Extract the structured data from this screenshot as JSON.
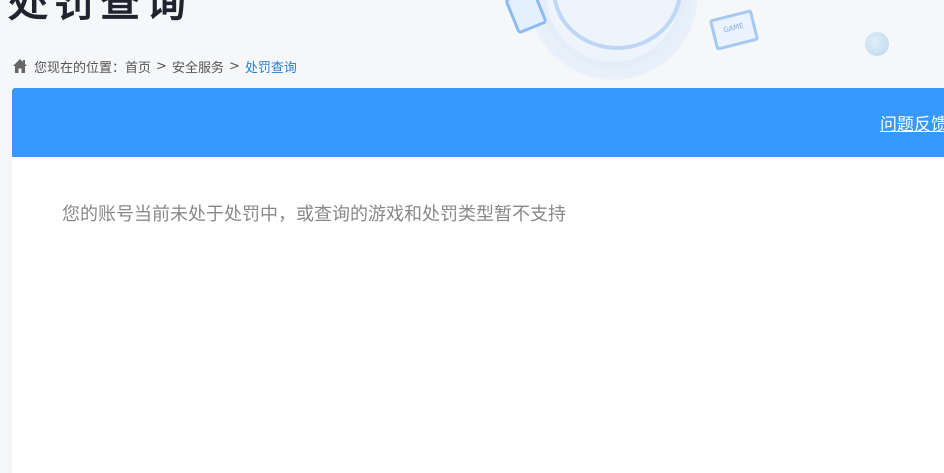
{
  "banner": {
    "title": "处罚查询",
    "monitor_text": "GAME"
  },
  "breadcrumb": {
    "prefix": "您现在的位置：",
    "items": [
      "首页",
      "安全服务",
      "处罚查询"
    ],
    "separator": ">"
  },
  "panel": {
    "feedback_link": "问题反馈",
    "message": "您的账号当前未处于处罚中，或查询的游戏和处罚类型暂不支持"
  },
  "colors": {
    "header_blue": "#3798fd",
    "link_current": "#2b7fd3",
    "message_gray": "#888888"
  }
}
